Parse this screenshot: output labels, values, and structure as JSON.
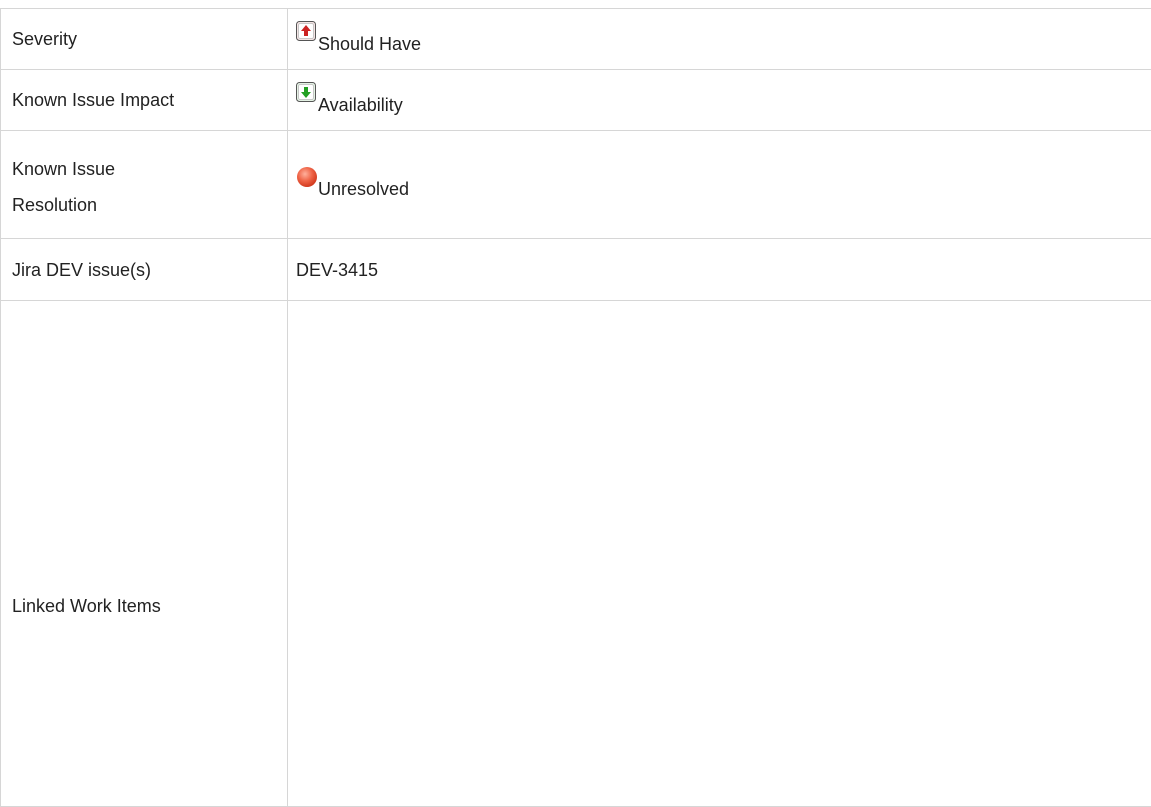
{
  "fields": [
    {
      "label": "Severity",
      "value": "Should Have",
      "icon": "priority-up-icon",
      "icon_color": "#cc2222"
    },
    {
      "label": "Known Issue Impact",
      "value": "Availability",
      "icon": "priority-down-icon",
      "icon_color": "#22a022"
    },
    {
      "label": "Known Issue Resolution",
      "label_line1": "Known Issue",
      "label_line2": "Resolution",
      "value": "Unresolved",
      "icon": "status-red-circle-icon",
      "icon_color": "#ea5a3c"
    },
    {
      "label": "Jira DEV issue(s)",
      "value": "DEV-3415"
    },
    {
      "label": "Linked Work Items",
      "value": ""
    }
  ]
}
